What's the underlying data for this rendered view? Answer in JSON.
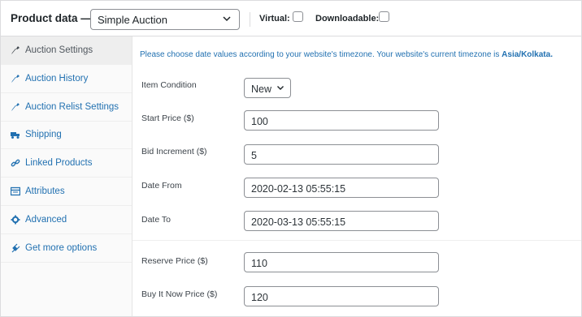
{
  "header": {
    "title": "Product data —",
    "product_type": "Simple Auction",
    "virtual_label": "Virtual:",
    "downloadable_label": "Downloadable:"
  },
  "sidebar": {
    "items": [
      {
        "label": "Auction Settings",
        "icon": "wrench-icon"
      },
      {
        "label": "Auction History",
        "icon": "wrench-icon"
      },
      {
        "label": "Auction Relist Settings",
        "icon": "wrench-icon"
      },
      {
        "label": "Shipping",
        "icon": "truck-icon"
      },
      {
        "label": "Linked Products",
        "icon": "link-icon"
      },
      {
        "label": "Attributes",
        "icon": "table-icon"
      },
      {
        "label": "Advanced",
        "icon": "gear-icon"
      },
      {
        "label": "Get more options",
        "icon": "plugin-icon"
      }
    ]
  },
  "main": {
    "notice_text": "Please choose date values according to your website's timezone. Your website's current timezone is ",
    "notice_timezone": "Asia/Kolkata.",
    "fields": [
      {
        "label": "Item Condition",
        "value": "New"
      },
      {
        "label": "Start Price ($)",
        "value": "100"
      },
      {
        "label": "Bid Increment ($)",
        "value": "5"
      },
      {
        "label": "Date From",
        "value": "2020-02-13 05:55:15"
      },
      {
        "label": "Date To",
        "value": "2020-03-13 05:55:15"
      },
      {
        "label": "Reserve Price ($)",
        "value": "110"
      },
      {
        "label": "Buy It Now Price ($)",
        "value": "120"
      }
    ]
  },
  "colors": {
    "link": "#2271b1",
    "active_tab_bg": "#eeeeee"
  }
}
